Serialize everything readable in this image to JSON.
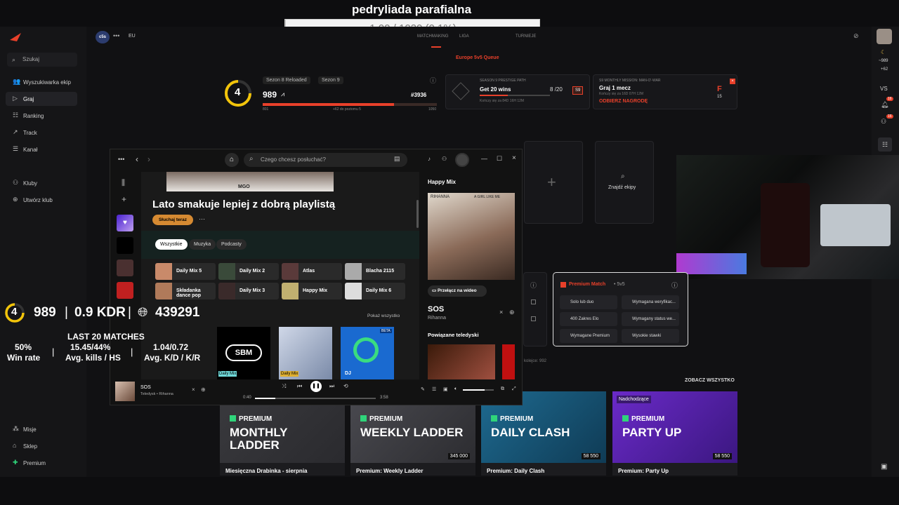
{
  "overlay": {
    "title": "pedryliada parafialna",
    "progress_text": "1.00 / 1020 (0.1%)",
    "progress_fraction": 0.001
  },
  "sidebar": {
    "search": "Szukaj",
    "items": [
      "Wyszukiwarka ekip",
      "Graj",
      "Ranking",
      "Track",
      "Kanał"
    ],
    "clubs": [
      "Kluby",
      "Utwórz klub"
    ],
    "bottom": [
      "Misje",
      "Sklep",
      "Premium"
    ]
  },
  "topbar": {
    "logo": "c5s",
    "region": "EU",
    "tabs": [
      "MATCHMAKING",
      "LIGA",
      "TURNIEJE"
    ]
  },
  "queue": "Europe 5v5 Queue",
  "stats": {
    "level": "4",
    "season_a": "Sezon 8 Reloaded",
    "season_b": "Sezon 9",
    "elo": "989",
    "rank": "#3936",
    "min": "801",
    "max": "1050",
    "hint": "+62 do poziomu 5"
  },
  "prestige": {
    "label": "SEASON 9 PRESTIGE PATH",
    "title": "Get 20 wins",
    "progress": "8 /20",
    "badge": "S9",
    "note": "Kończy się za 84D 16H 12M"
  },
  "mission": {
    "label": "S9 MONTHLY MISSION: MAN-O'-WAR",
    "title": "Graj 1 mecz",
    "note": "Kończy się za 16D 07H 12M",
    "reward": "ODBIERZ NAGRODĘ",
    "count": "15",
    "grade": "F"
  },
  "find_team": "Znajdź ekipy",
  "premium_match": {
    "title": "Premium Match",
    "sub": "• 5v5",
    "rows": [
      "Solo lub duo",
      "Wymagana weryfikac...",
      "400 Zakres Elo",
      "Wymagany status we...",
      "Wymagane Premium",
      "Wysokie stawki"
    ]
  },
  "right_col": {
    "elo": "~989",
    "diff": "+62",
    "vs": "VS",
    "b1": "16",
    "b2": "16"
  },
  "spotify": {
    "search": "Czego chcesz posłuchać?",
    "banner": "MGO",
    "headline": "Lato smakuje lepiej z dobrą playlistą",
    "listen": "Słuchaj teraz",
    "chips": [
      "Wszystkie",
      "Muzyka",
      "Podcasty"
    ],
    "tiles": [
      "Daily Mix 5",
      "Daily Mix 2",
      "Atlas",
      "Blacha 2115",
      "Składanka dance pop",
      "Daily Mix 3",
      "Happy Mix",
      "Daily Mix 6"
    ],
    "show_all": "Pokaż wszystko",
    "sbm": "SBM",
    "dj": "DJ",
    "beta": "BETA",
    "daily_mix": "Daily Mix",
    "side_title": "Happy Mix",
    "album_artist": "RIHANNA",
    "album_name": "A GIRL LIKE ME",
    "video_btn": "Przełącz na wideo",
    "song": "SOS",
    "artist": "Rihanna",
    "related": "Powiązane teledyski",
    "np_title": "SOS",
    "np_sub": "Teledysk • Rihanna",
    "time_cur": "0:40",
    "time_total": "3:58",
    "progress": 0.17,
    "volume": 0.7
  },
  "hud": {
    "level": "4",
    "elo": "989",
    "kdr": "0.9 KDR",
    "rank": "439291",
    "last20": "LAST 20 MATCHES",
    "winrate": "50%",
    "winrate_l": "Win rate",
    "kills": "15.45/44%",
    "kills_l": "Avg. kills / HS",
    "kd": "1.04/0.72",
    "kd_l": "Avg. K/D / K/R"
  },
  "promo_header": "ZOBACZ WSZYSTKO",
  "queue_line": "kolejce: 992",
  "promos": [
    {
      "pre": "PREMIUM",
      "big": "MONTHLY LADDER",
      "cap": "Miesięczna Drabinka - sierpnia",
      "price": "",
      "tag": ""
    },
    {
      "pre": "PREMIUM",
      "big": "WEEKLY LADDER",
      "cap": "Premium: Weekly Ladder",
      "price": "345 000",
      "tag": ""
    },
    {
      "pre": "PREMIUM",
      "big": "DAILY CLASH",
      "cap": "Premium: Daily Clash",
      "price": "58 550",
      "tag": ""
    },
    {
      "pre": "PREMIUM",
      "big": "PARTY UP",
      "cap": "Premium: Party Up",
      "price": "58 550",
      "tag": "Nadchodzące"
    }
  ],
  "colors": {
    "accent": "#e8402a",
    "premium": "#2fd47a",
    "purple": "#5b2bb0"
  }
}
